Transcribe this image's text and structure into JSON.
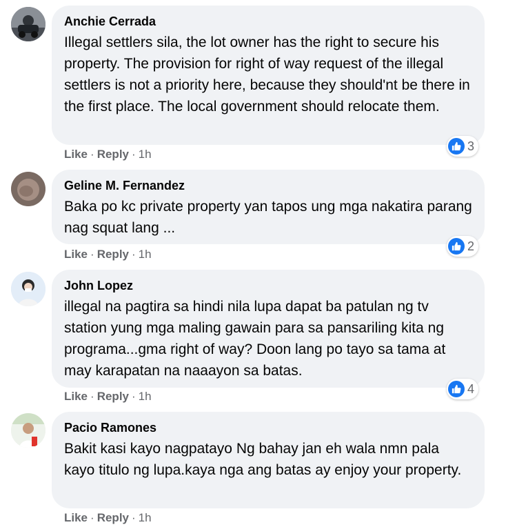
{
  "comments": [
    {
      "author": "Anchie Cerrada",
      "text": "Illegal settlers sila, the lot owner has the right to secure his property. The provision for right of way request of the illegal settlers is not a priority here, because they should'nt be there in the first place. The local government should relocate them.",
      "reactions": "3",
      "like": "Like",
      "reply": "Reply",
      "sep": "·",
      "time": "1h"
    },
    {
      "author": "Geline M. Fernandez",
      "text": "Baka po kc private property yan tapos ung mga nakatira parang nag squat lang ...",
      "reactions": "2",
      "like": "Like",
      "reply": "Reply",
      "sep": "·",
      "time": "1h"
    },
    {
      "author": "John Lopez",
      "text": "illegal na pagtira sa hindi nila lupa dapat ba patulan ng tv station yung mga maling gawain para sa pansariling kita ng programa...gma right of way? Doon lang po tayo sa tama at may karapatan na naaayon sa batas.",
      "reactions": "4",
      "like": "Like",
      "reply": "Reply",
      "sep": "·",
      "time": "1h"
    },
    {
      "author": "Pacio Ramones",
      "text": "Bakit kasi kayo nagpatayo Ng bahay jan eh wala nmn pala kayo titulo ng lupa.kaya nga ang batas ay enjoy your property.",
      "like": "Like",
      "reply": "Reply",
      "sep": "·",
      "time": "1h"
    }
  ],
  "colors": {
    "bubble": "#f0f2f5",
    "like_blue": "#1877f2",
    "meta_gray": "#65676b"
  }
}
